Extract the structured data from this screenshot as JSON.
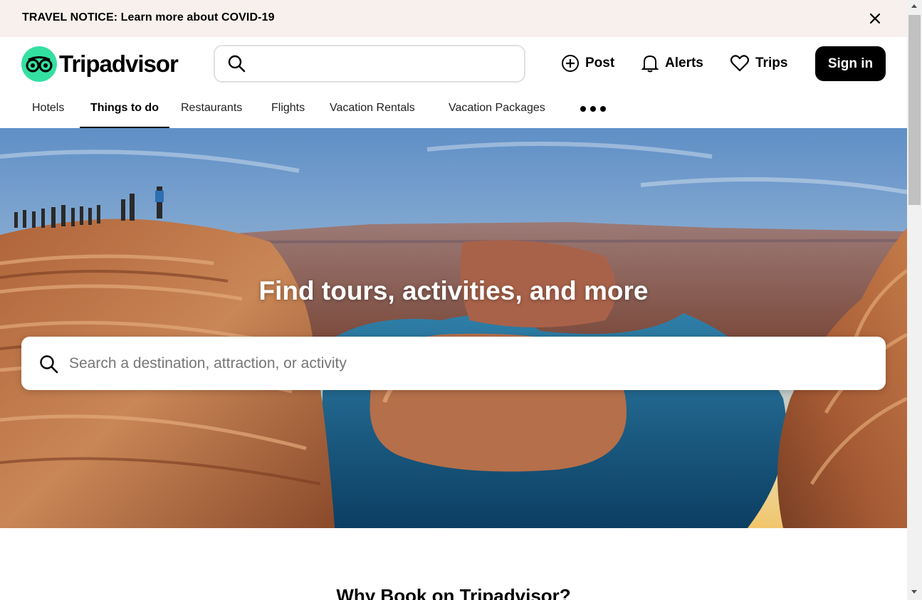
{
  "notice": {
    "text": "TRAVEL NOTICE: Learn more about COVID-19",
    "close_icon": "close-icon"
  },
  "header": {
    "logo_text": "Tripadvisor",
    "logo_icon": "owl-eyes-icon",
    "search_placeholder": "",
    "actions": {
      "post": "Post",
      "alerts": "Alerts",
      "trips": "Trips"
    },
    "signin": "Sign in"
  },
  "nav": {
    "tabs": [
      {
        "label": "Hotels",
        "active": false
      },
      {
        "label": "Things to do",
        "active": true
      },
      {
        "label": "Restaurants",
        "active": false
      },
      {
        "label": "Flights",
        "active": false
      },
      {
        "label": "Vacation Rentals",
        "active": false
      },
      {
        "label": "Vacation Packages",
        "active": false
      }
    ],
    "more_icon": "more-dots-icon"
  },
  "hero": {
    "title": "Find tours, activities, and more",
    "search_placeholder": "Search a destination, attraction, or activity"
  },
  "below": {
    "heading": "Why Book on Tripadvisor?"
  },
  "colors": {
    "brand_green": "#34e0a1",
    "notice_bg": "#f7f0ec",
    "signin_bg": "#000000"
  }
}
